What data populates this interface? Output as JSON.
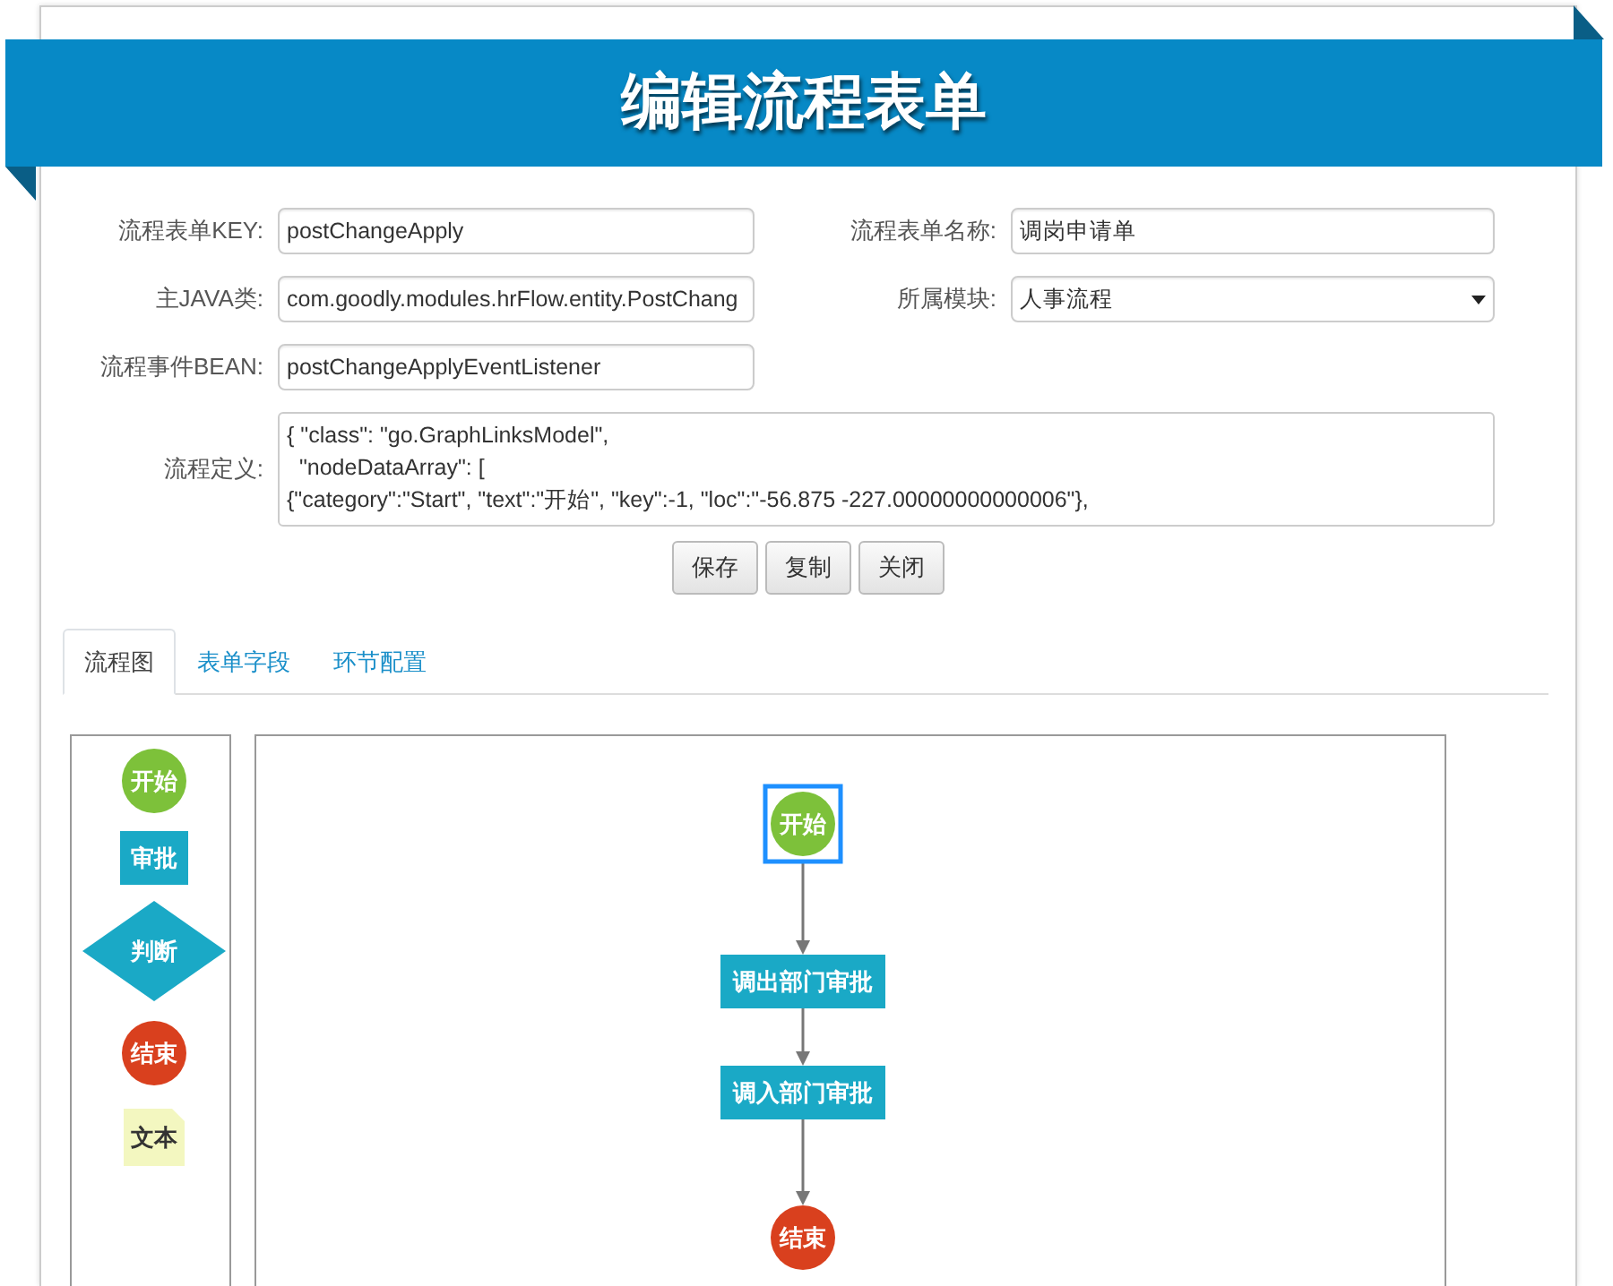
{
  "title": "编辑流程表单",
  "fields": [
    {
      "label": "流程表单KEY:",
      "value": "postChangeApply",
      "kind": "text"
    },
    {
      "label": "流程表单名称:",
      "value": "调岗申请单",
      "kind": "text"
    },
    {
      "label": "主JAVA类:",
      "value": "com.goodly.modules.hrFlow.entity.PostChang",
      "kind": "text"
    },
    {
      "label": "所属模块:",
      "value": "人事流程",
      "kind": "select"
    },
    {
      "label": "流程事件BEAN:",
      "value": "postChangeApplyEventListener",
      "kind": "text"
    }
  ],
  "definition": {
    "label": "流程定义:",
    "lines": [
      "{ \"class\": \"go.GraphLinksModel\",",
      "  \"nodeDataArray\": [",
      "{\"category\":\"Start\", \"text\":\"开始\", \"key\":-1, \"loc\":\"-56.875 -227.00000000000006\"},"
    ]
  },
  "buttons": [
    "保存",
    "复制",
    "关闭"
  ],
  "tabs": [
    {
      "label": "流程图",
      "selected": true
    },
    {
      "label": "表单字段",
      "selected": false
    },
    {
      "label": "环节配置",
      "selected": false
    }
  ],
  "palette": [
    {
      "kind": "start",
      "text": "开始"
    },
    {
      "kind": "step",
      "text": "审批"
    },
    {
      "kind": "decision",
      "text": "判断"
    },
    {
      "kind": "end",
      "text": "结束"
    },
    {
      "kind": "note",
      "text": "文本"
    }
  ],
  "diagram": {
    "nodes": [
      {
        "kind": "start",
        "text": "开始",
        "selected": true
      },
      {
        "kind": "step",
        "text": "调出部门审批",
        "selected": false
      },
      {
        "kind": "step",
        "text": "调入部门审批",
        "selected": false
      },
      {
        "kind": "end",
        "text": "结束",
        "selected": false
      }
    ]
  }
}
